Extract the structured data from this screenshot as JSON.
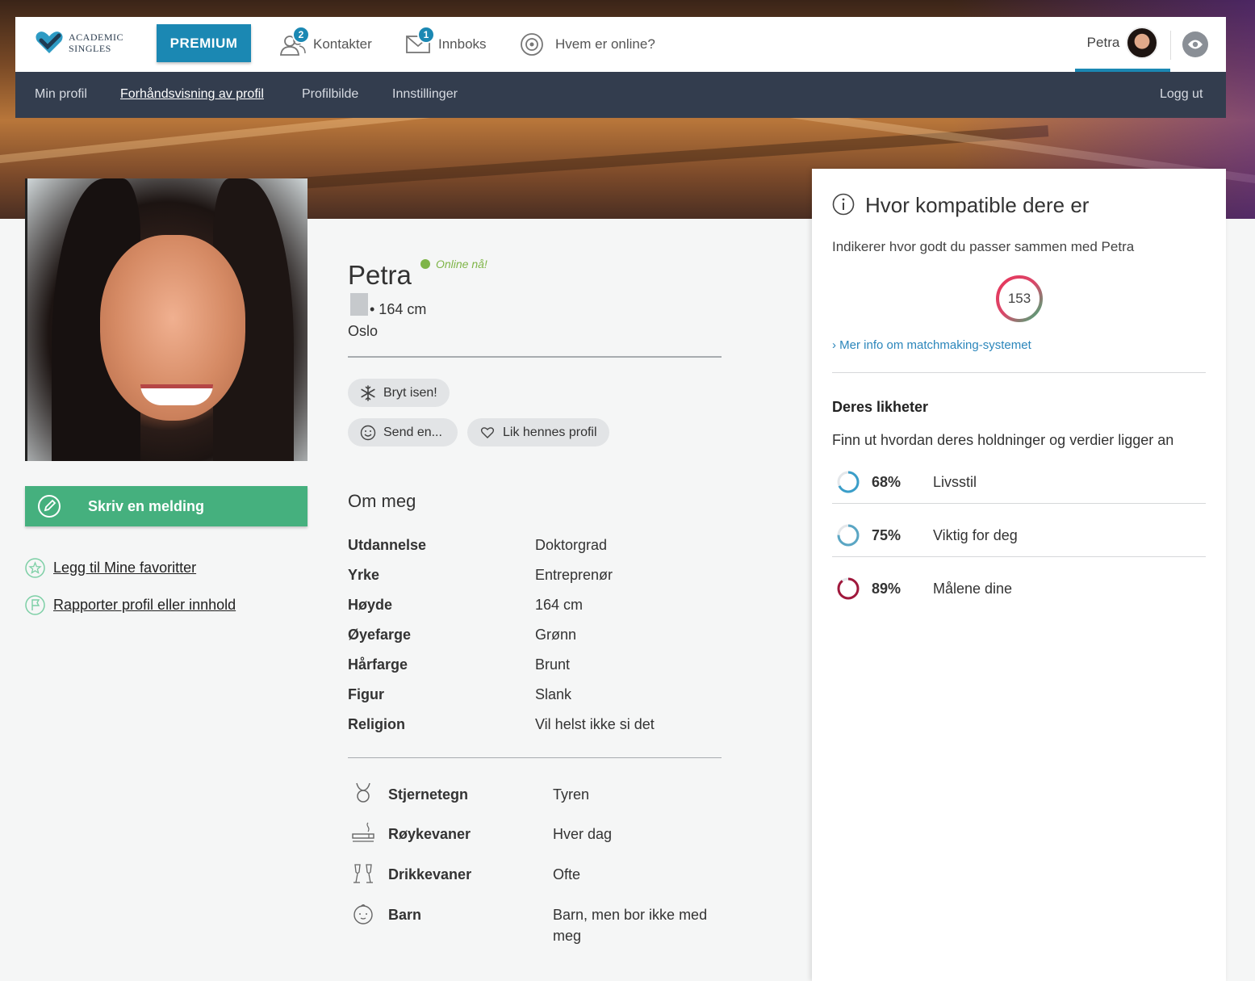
{
  "brand": {
    "line1": "ACADEMIC",
    "line2": "SINGLES"
  },
  "topnav": {
    "premium_label": "PREMIUM",
    "contacts_label": "Kontakter",
    "contacts_badge": "2",
    "inbox_label": "Innboks",
    "inbox_badge": "1",
    "online_label": "Hvem er online?",
    "user_name": "Petra"
  },
  "subnav": {
    "items": [
      "Min profil",
      "Forhåndsvisning av profil",
      "Profilbilde",
      "Innstillinger"
    ],
    "logout": "Logg ut"
  },
  "profile": {
    "name": "Petra",
    "online_status": "Online nå!",
    "height_line": "• 164 cm",
    "city": "Oslo",
    "icebreaker": "Bryt isen!",
    "send": "Send en...",
    "like": "Lik hennes profil"
  },
  "sidebar": {
    "write_message": "Skriv en melding",
    "add_favorite": "Legg til Mine favoritter",
    "report": "Rapporter profil eller innhold"
  },
  "about": {
    "heading": "Om meg",
    "rows": [
      {
        "label": "Utdannelse",
        "value": "Doktorgrad"
      },
      {
        "label": "Yrke",
        "value": "Entreprenør"
      },
      {
        "label": "Høyde",
        "value": "164 cm"
      },
      {
        "label": "Øyefarge",
        "value": "Grønn"
      },
      {
        "label": "Hårfarge",
        "value": "Brunt"
      },
      {
        "label": "Figur",
        "value": "Slank"
      },
      {
        "label": "Religion",
        "value": "Vil helst ikke si det"
      }
    ],
    "habits": [
      {
        "icon": "taurus-icon",
        "label": "Stjernetegn",
        "value": "Tyren"
      },
      {
        "icon": "cigarette-icon",
        "label": "Røykevaner",
        "value": "Hver dag"
      },
      {
        "icon": "champagne-icon",
        "label": "Drikkevaner",
        "value": "Ofte"
      },
      {
        "icon": "baby-icon",
        "label": "Barn",
        "value": "Barn, men bor ikke med meg"
      }
    ]
  },
  "compat": {
    "title": "Hvor kompatible dere er",
    "subtitle": "Indikerer hvor godt du passer sammen med Petra",
    "score": "153",
    "more_link": "Mer info om matchmaking-systemet",
    "similarities_title": "Deres likheter",
    "similarities_desc": "Finn ut hvordan deres holdninger og verdier ligger an",
    "items": [
      {
        "percent": "68%",
        "value": 68,
        "label": "Livsstil",
        "color": "#3a9ec9"
      },
      {
        "percent": "75%",
        "value": 75,
        "label": "Viktig for deg",
        "color": "#5aa6c4"
      },
      {
        "percent": "89%",
        "value": 89,
        "label": "Målene dine",
        "color": "#a0183c"
      }
    ]
  },
  "colors": {
    "accent": "#1b88b3",
    "green": "#45b07e",
    "navbar": "#333d4e",
    "online": "#7fb548"
  }
}
